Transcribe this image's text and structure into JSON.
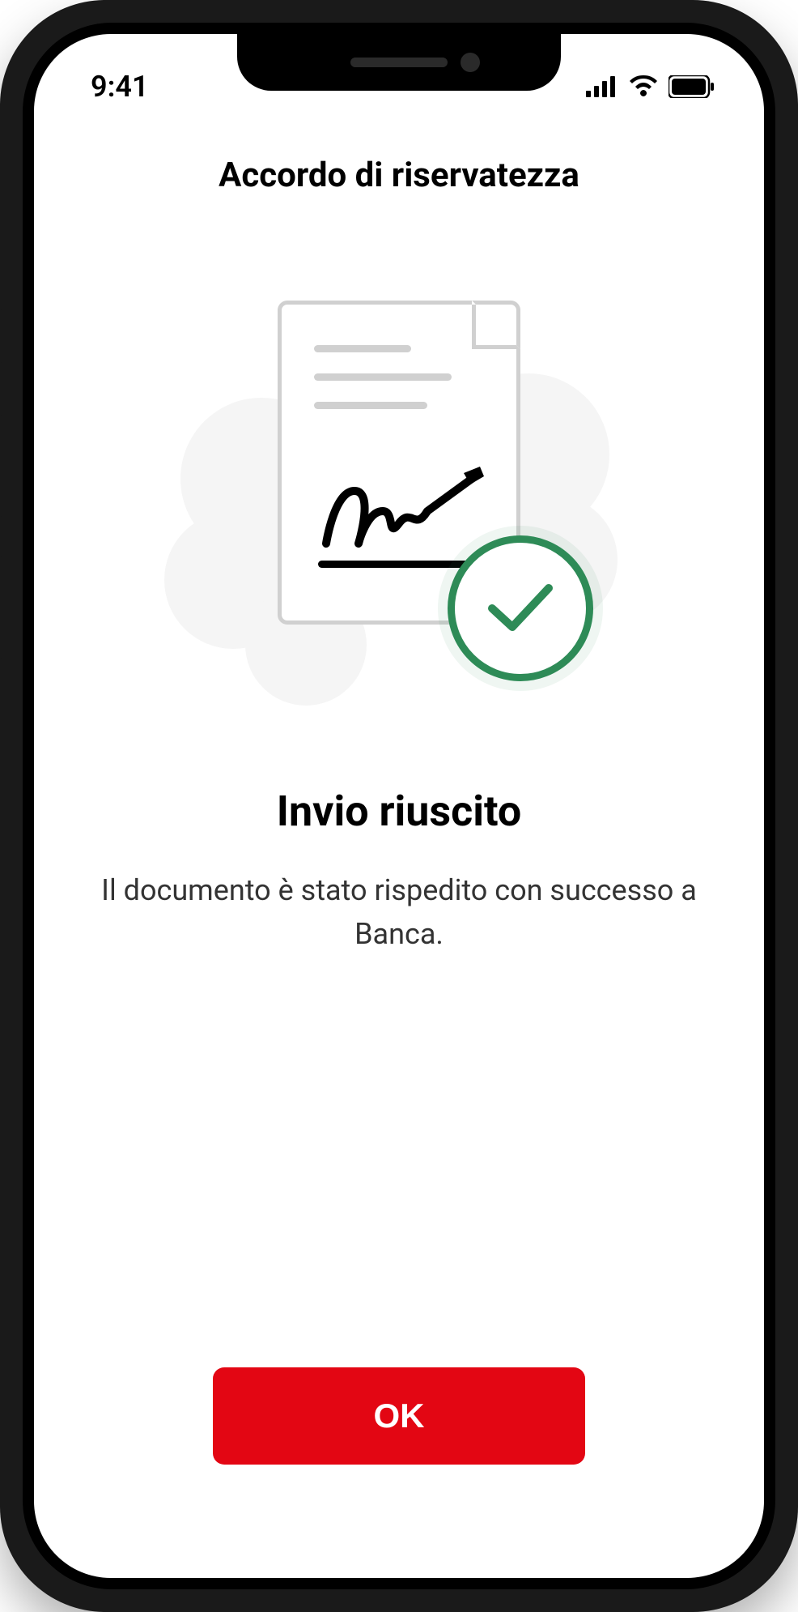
{
  "statusBar": {
    "time": "9:41"
  },
  "header": {
    "title": "Accordo di riservatezza"
  },
  "content": {
    "successTitle": "Invio riuscito",
    "successMessage": "Il documento è stato rispedito con successo a Banca."
  },
  "footer": {
    "okButtonLabel": "OK"
  }
}
